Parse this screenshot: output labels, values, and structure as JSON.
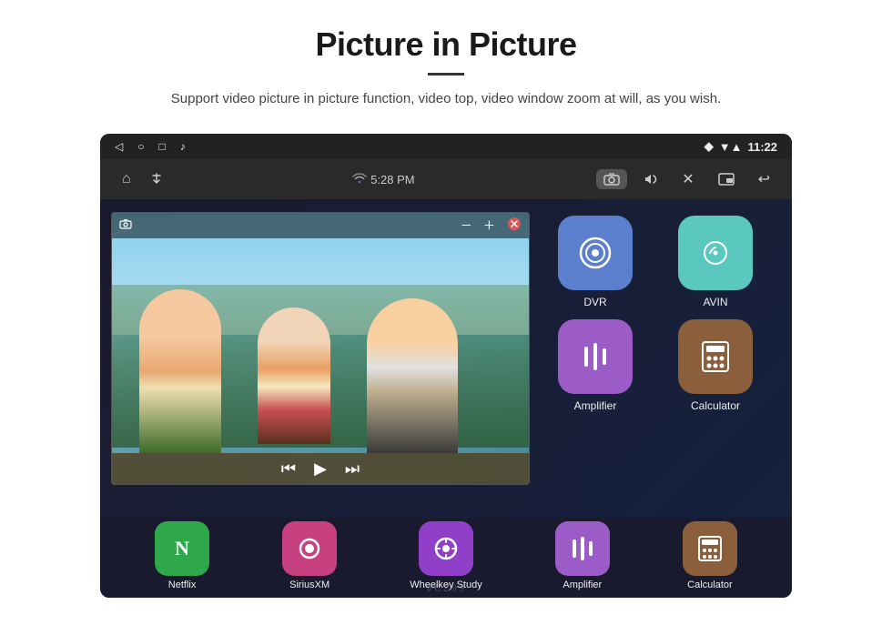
{
  "header": {
    "title": "Picture in Picture",
    "subtitle": "Support video picture in picture function, video top, video window zoom at will, as you wish."
  },
  "status_bar": {
    "time": "11:22",
    "wifi": "▼▲",
    "location": "📍"
  },
  "car_toolbar": {
    "home_icon": "⌂",
    "usb_icon": "⚡",
    "time": "5:28 PM",
    "camera_icon": "📷",
    "volume_icon": "🔊",
    "close_icon": "✕",
    "pip_icon": "⧉",
    "back_icon": "↩"
  },
  "pip_window": {
    "minus_label": "−",
    "plus_label": "+",
    "close_label": "✕"
  },
  "apps": {
    "dvr": {
      "label": "DVR",
      "color": "#5b7fcc"
    },
    "avin": {
      "label": "AVIN",
      "color": "#5bc8c0"
    },
    "amplifier": {
      "label": "Amplifier",
      "color": "#9b5cc8"
    },
    "calculator": {
      "label": "Calculator",
      "color": "#8b5e3c"
    }
  },
  "bottom_apps": {
    "netflix": {
      "label": "Netflix",
      "color": "#2ea84a"
    },
    "sirius": {
      "label": "SiriusXM",
      "color": "#c84080"
    },
    "wheelkey": {
      "label": "Wheelkey Study",
      "color": "#9040c8"
    },
    "amplifier": {
      "label": "Amplifier",
      "color": "#9b5cc8"
    },
    "calculator": {
      "label": "Calculator",
      "color": "#8b5e3c"
    }
  },
  "watermark": "VCZ99"
}
